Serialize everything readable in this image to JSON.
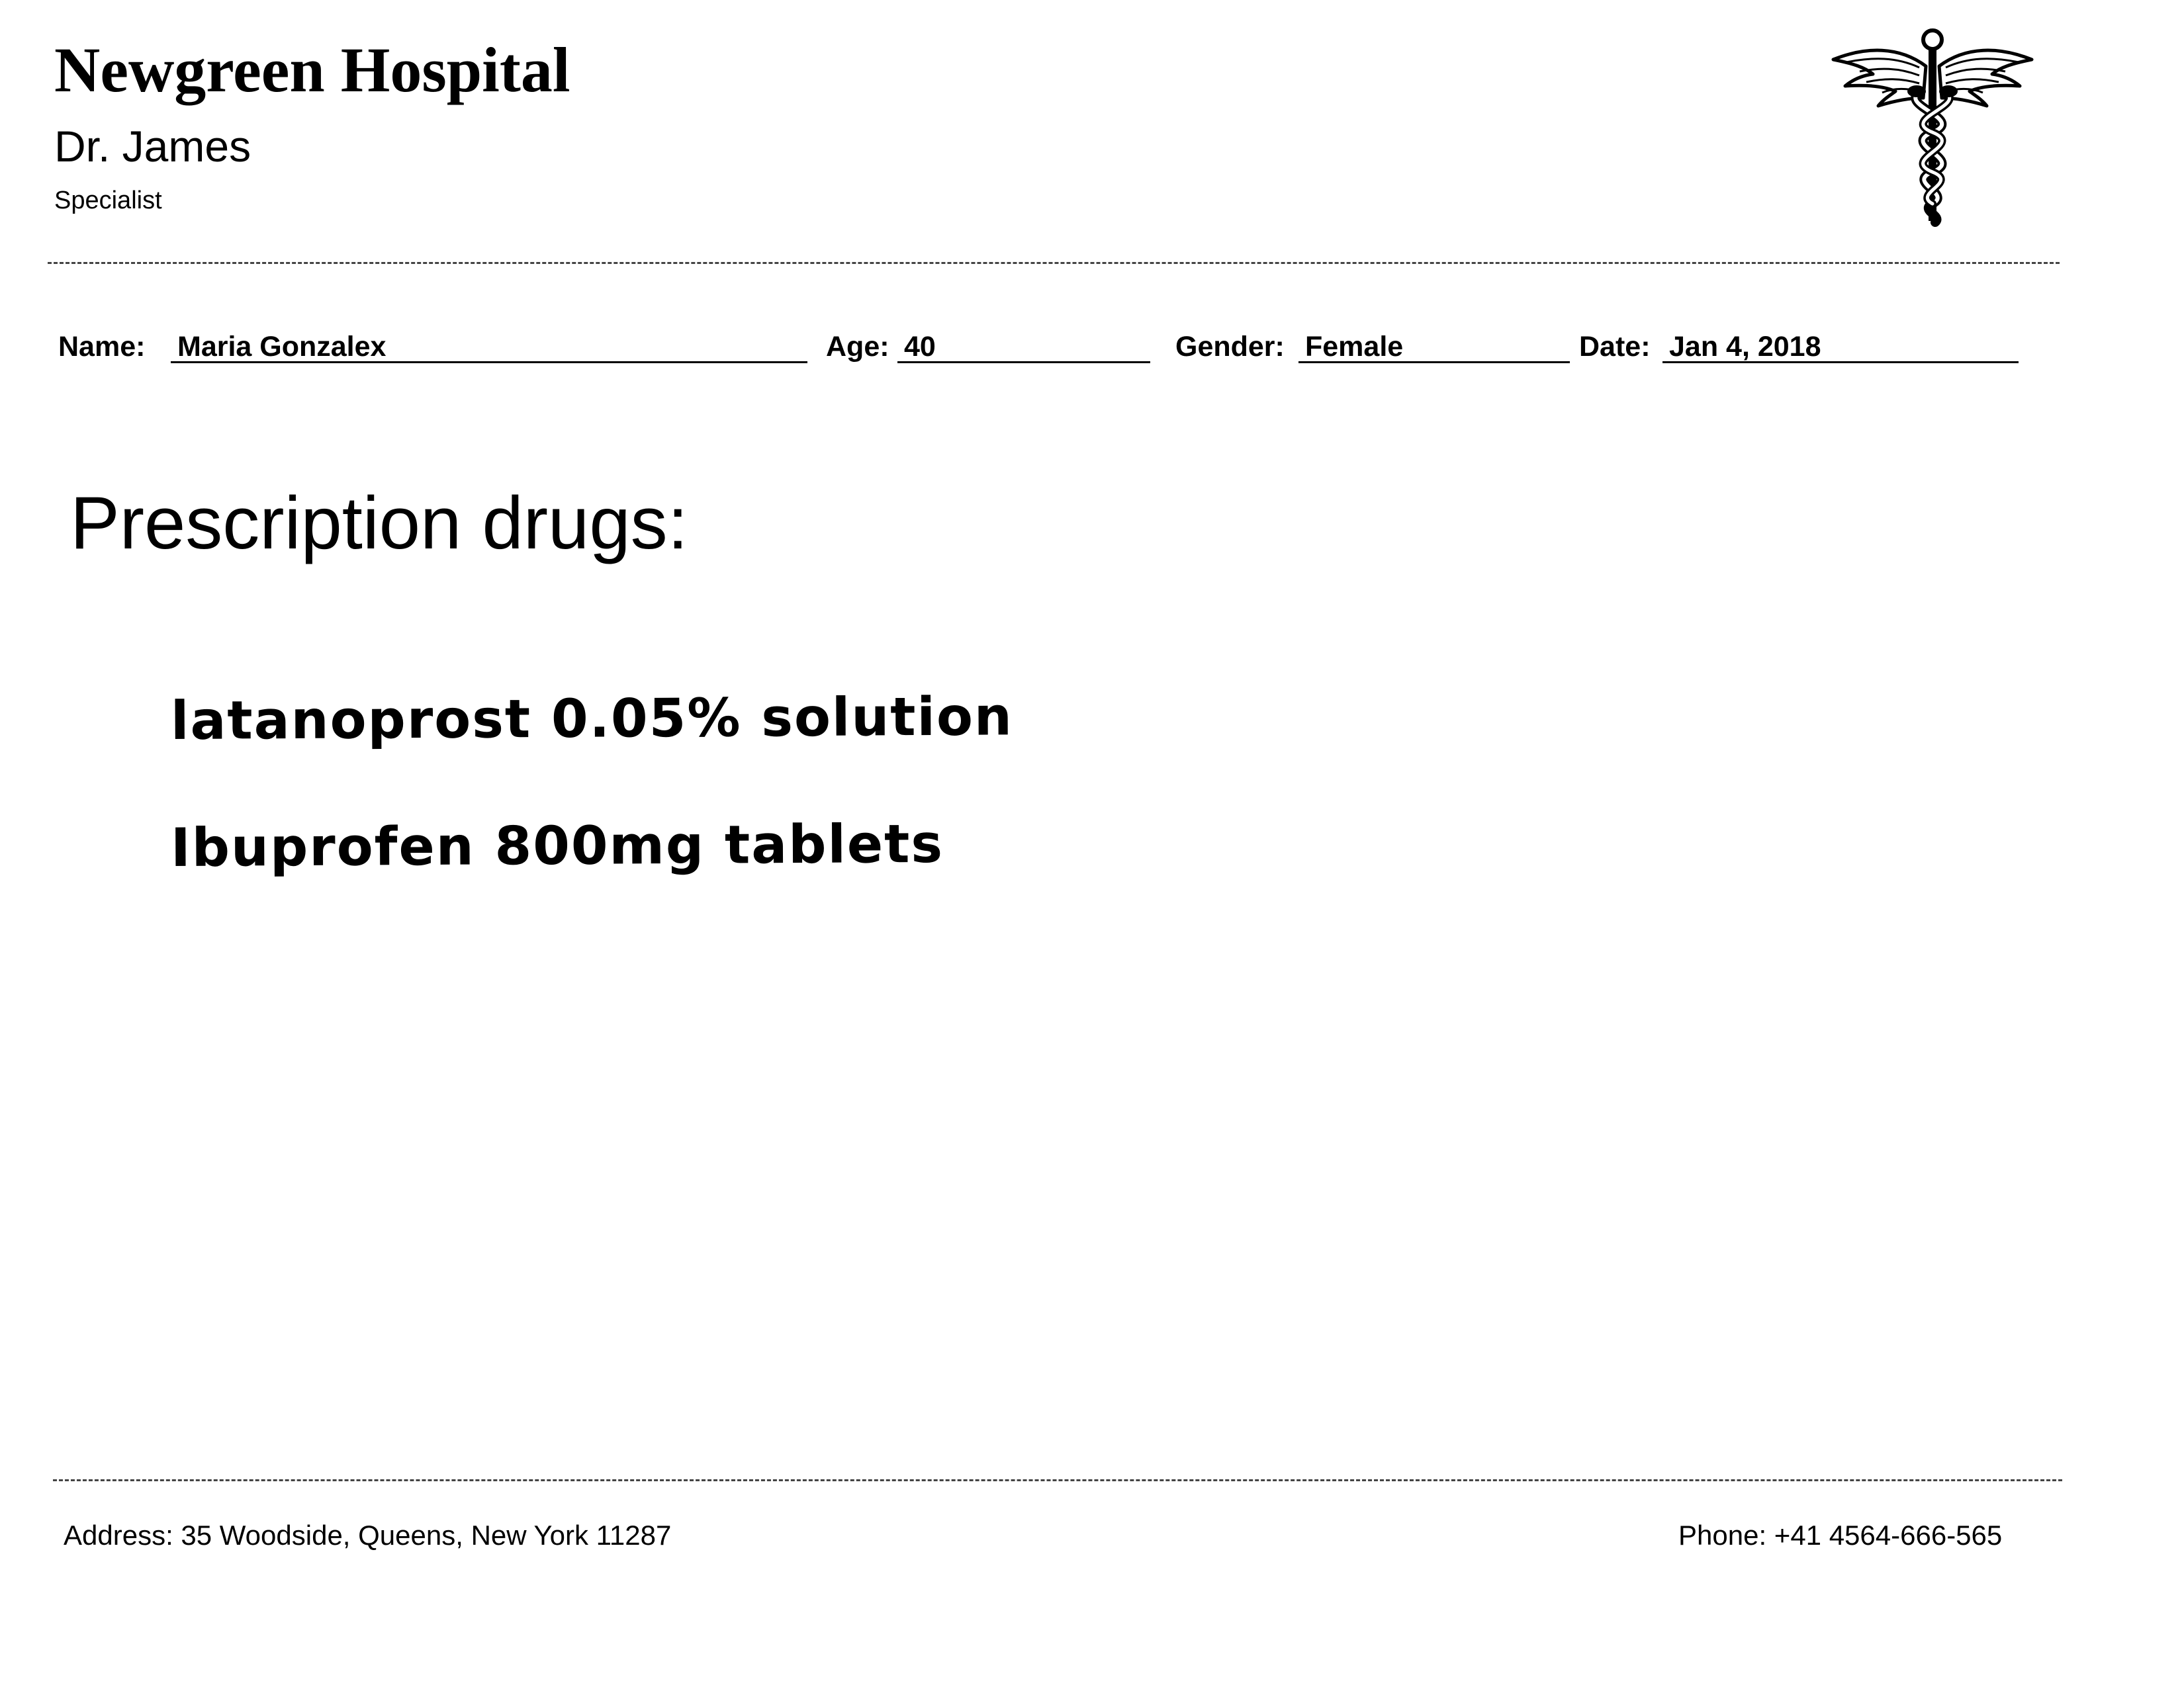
{
  "header": {
    "hospital_name": "Newgreen Hospital",
    "doctor_name": "Dr. James",
    "doctor_title": "Specialist",
    "logo_icon": "caduceus-icon"
  },
  "patient": {
    "name_label": "Name:",
    "name_value": "Maria Gonzalex",
    "age_label": "Age:",
    "age_value": "40",
    "gender_label": "Gender:",
    "gender_value": "Female",
    "date_label": "Date:",
    "date_value": "Jan 4, 2018"
  },
  "prescription": {
    "heading": "Prescription drugs:",
    "drugs": [
      "latanoprost 0.05% solution",
      "Ibuprofen 800mg tablets"
    ]
  },
  "footer": {
    "address": "Address: 35 Woodside, Queens, New York 11287",
    "phone": "Phone: +41 4564-666-565"
  }
}
